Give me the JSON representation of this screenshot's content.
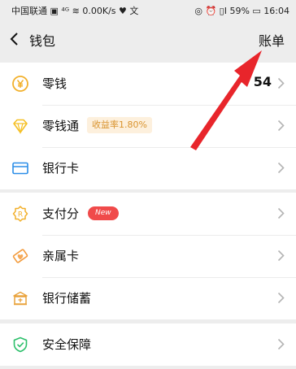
{
  "status_bar": {
    "left_text": "中国联通 ▣ ⁴ᴳ ≋ 0.00K/s ♥ 文",
    "right_text": "◎ ⏰ ▯I 59% ▭ 16:04"
  },
  "nav": {
    "title": "钱包",
    "bill_label": "账单"
  },
  "groups": [
    {
      "items": [
        {
          "label": "零钱",
          "icon": "yuan-coin-icon",
          "value": "54"
        },
        {
          "label": "零钱通",
          "icon": "diamond-icon",
          "tag": "收益率1.80%"
        },
        {
          "label": "银行卡",
          "icon": "bank-card-icon"
        }
      ]
    },
    {
      "items": [
        {
          "label": "支付分",
          "icon": "pay-score-icon",
          "tag": "New"
        },
        {
          "label": "亲属卡",
          "icon": "family-card-icon"
        },
        {
          "label": "银行储蓄",
          "icon": "bank-savings-icon"
        }
      ]
    },
    {
      "items": [
        {
          "label": "安全保障",
          "icon": "shield-check-icon"
        }
      ]
    }
  ],
  "colors": {
    "coin": "#f2b02b",
    "diamond": "#f5c026",
    "card": "#2b8ee8",
    "score": "#f2b02b",
    "family": "#f39a3b",
    "savings": "#e9a23b",
    "shield": "#2bbf6a",
    "arrow": "#e8252b"
  }
}
